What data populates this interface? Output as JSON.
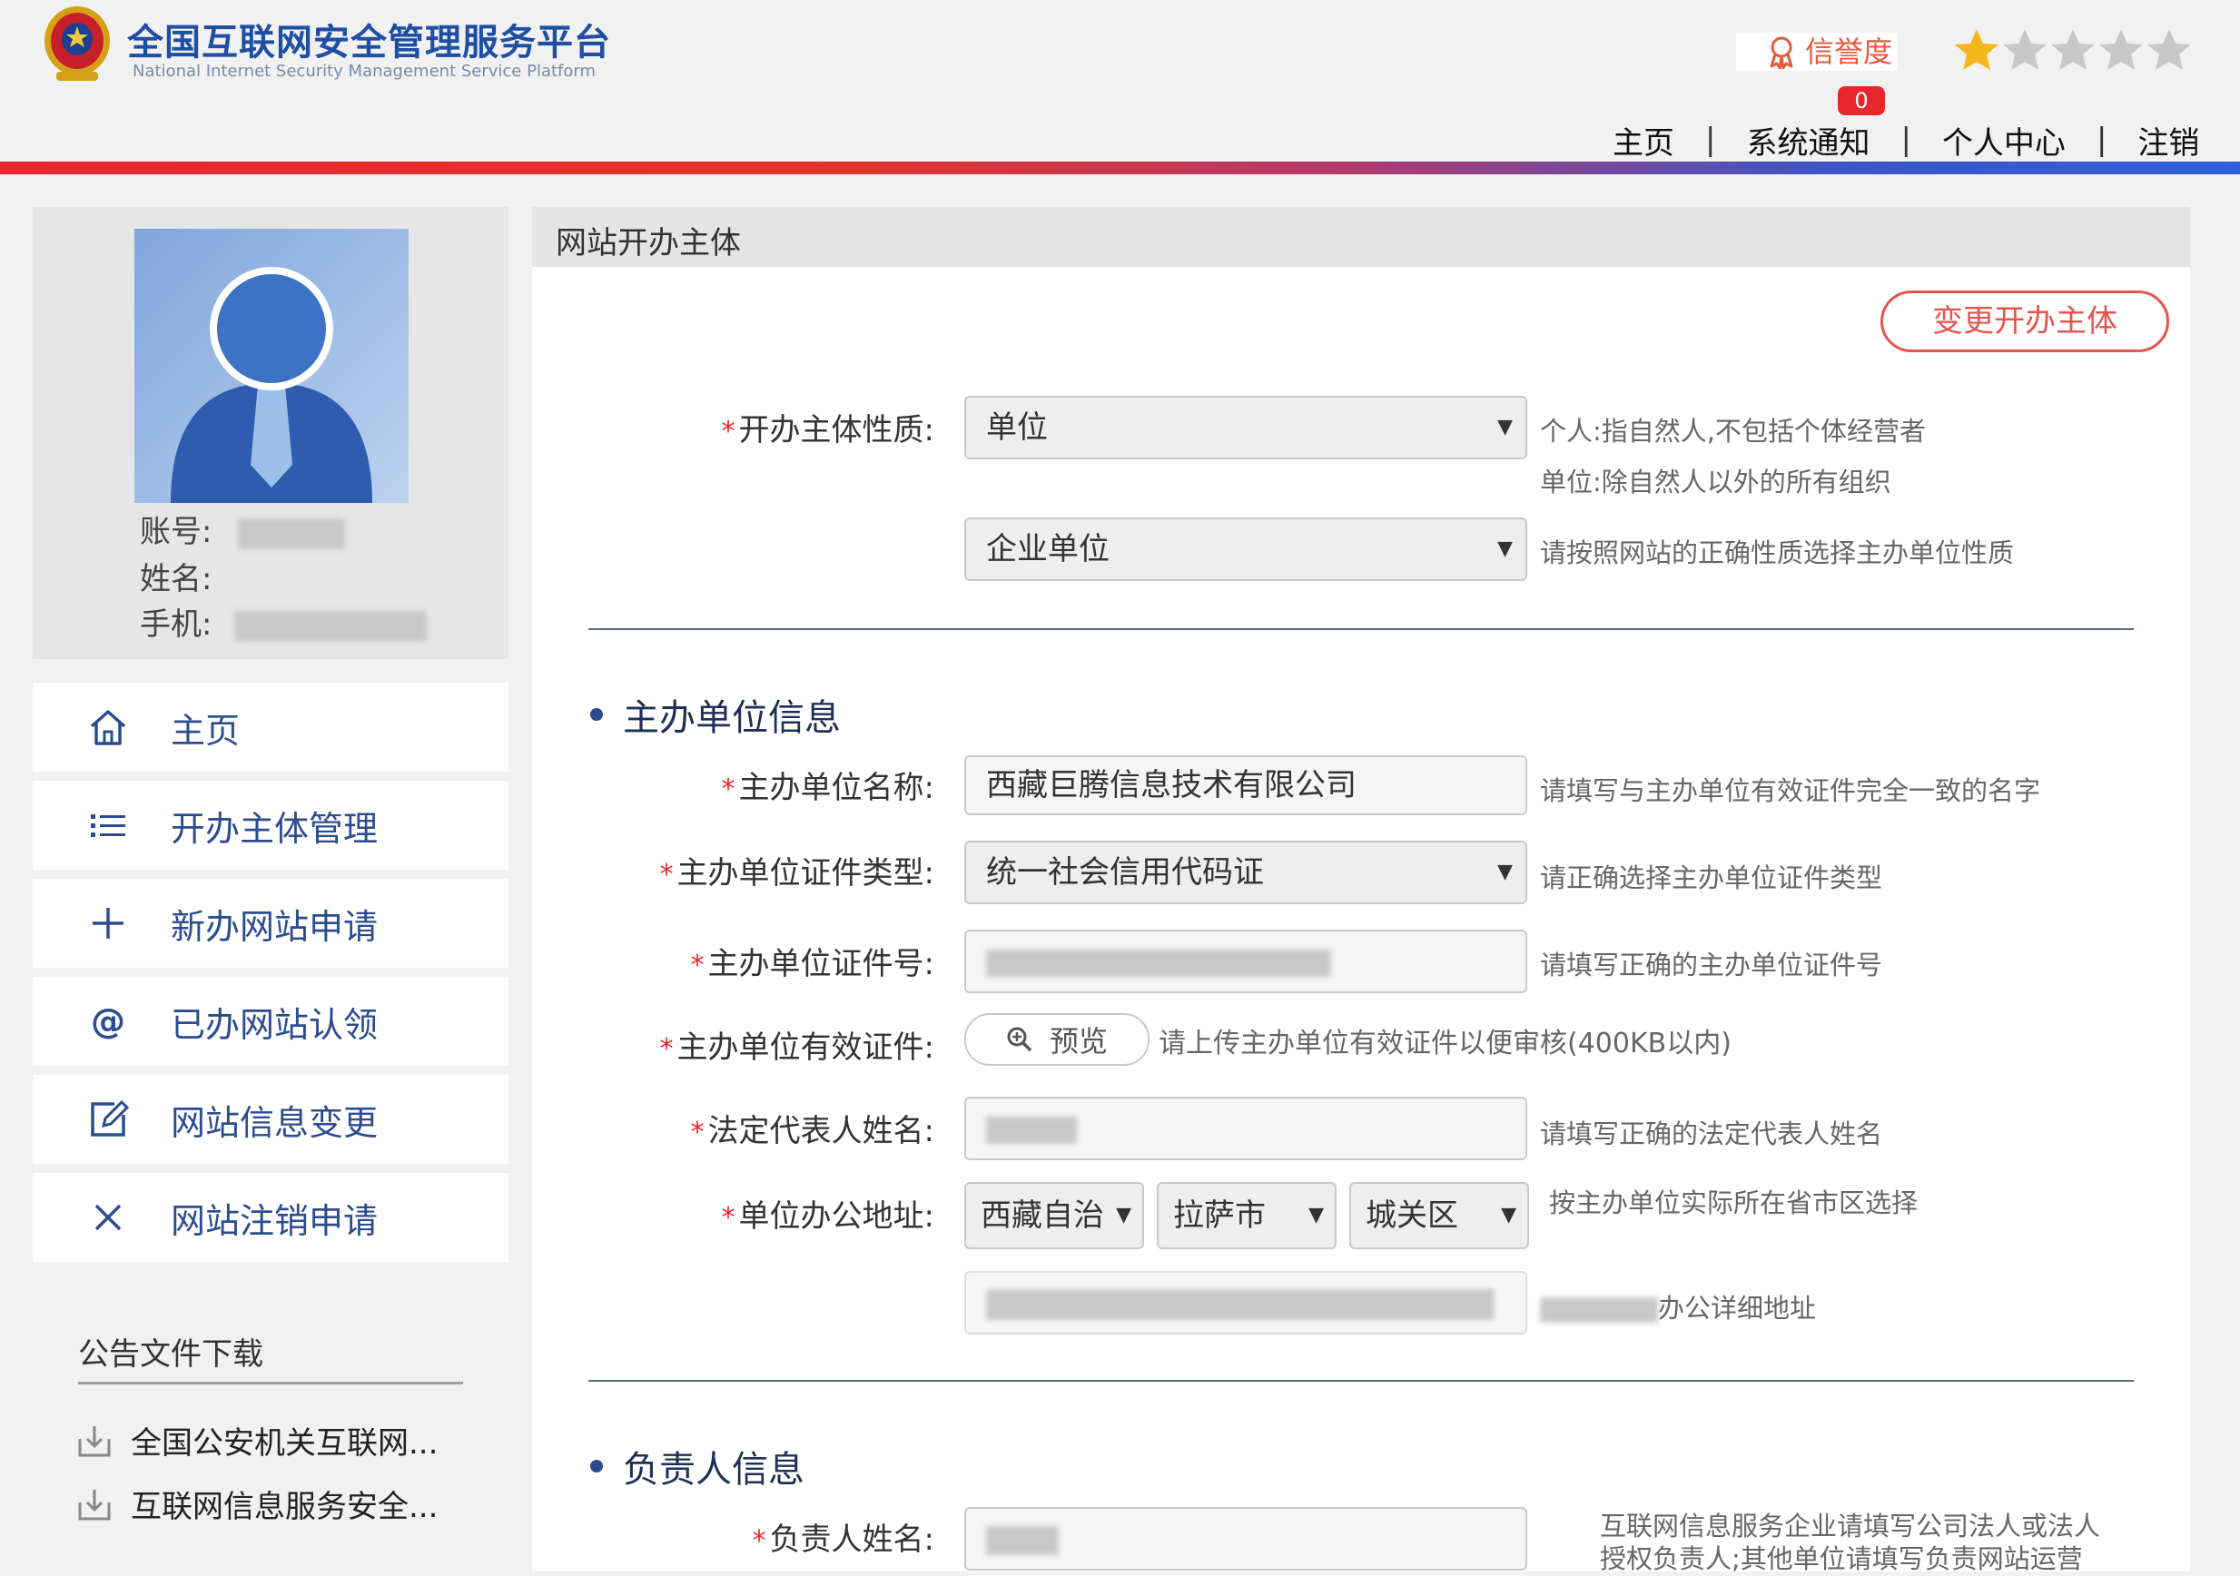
{
  "header": {
    "title": "全国互联网安全管理服务平台",
    "subtitle": "National Internet Security Management Service Platform",
    "credit_label": "信誉度",
    "credit_stars": 1,
    "credit_stars_total": 5,
    "notice_count": "0",
    "nav": [
      "主页",
      "系统通知",
      "个人中心",
      "注销"
    ],
    "nav_separator": "|"
  },
  "profile": {
    "account_label": "账号:",
    "name_label": "姓名:",
    "phone_label": "手机:"
  },
  "sidebar": {
    "items": [
      {
        "label": "主页",
        "icon": "home-icon"
      },
      {
        "label": "开办主体管理",
        "icon": "list-icon"
      },
      {
        "label": "新办网站申请",
        "icon": "plus-icon"
      },
      {
        "label": "已办网站认领",
        "icon": "at-icon"
      },
      {
        "label": "网站信息变更",
        "icon": "edit-icon"
      },
      {
        "label": "网站注销申请",
        "icon": "close-icon"
      }
    ],
    "downloads_title": "公告文件下载",
    "downloads": [
      "全国公安机关互联网...",
      "互联网信息服务安全..."
    ]
  },
  "panel": {
    "title": "网站开办主体",
    "change_button": "变更开办主体",
    "required_mark": "*",
    "entity_nature": {
      "label": "开办主体性质:",
      "value": "单位",
      "hint1": "个人:指自然人,不包括个体经营者",
      "hint2": "单位:除自然人以外的所有组织"
    },
    "unit_type": {
      "value": "企业单位",
      "hint": "请按照网站的正确性质选择主办单位性质"
    },
    "section_host": "主办单位信息",
    "host_name": {
      "label": "主办单位名称:",
      "value": "西藏巨腾信息技术有限公司",
      "hint": "请填写与主办单位有效证件完全一致的名字"
    },
    "cert_type": {
      "label": "主办单位证件类型:",
      "value": "统一社会信用代码证",
      "hint": "请正确选择主办单位证件类型"
    },
    "cert_no": {
      "label": "主办单位证件号:",
      "hint": "请填写正确的主办单位证件号"
    },
    "cert_file": {
      "label": "主办单位有效证件:",
      "button": "预览",
      "hint": "请上传主办单位有效证件以便审核(400KB以内)"
    },
    "legal_rep": {
      "label": "法定代表人姓名:",
      "hint": "请填写正确的法定代表人姓名"
    },
    "address": {
      "label": "单位办公地址:",
      "province": "西藏自治",
      "city": "拉萨市",
      "district": "城关区",
      "hint": "按主办单位实际所在省市区选择",
      "detail_hint": "办公详细地址"
    },
    "section_owner": "负责人信息",
    "owner_name": {
      "label": "负责人姓名:",
      "hint1": "互联网信息服务企业请填写公司法人或法人",
      "hint2": "授权负责人;其他单位请填写负责网站运营"
    }
  },
  "colors": {
    "brand_blue": "#1f4fa2",
    "menu_text": "#2b4c8f",
    "accent_red": "#e8262c",
    "button_red": "#e6544d",
    "star_gold": "#f5b61b",
    "star_grey": "#c8c8c8"
  }
}
